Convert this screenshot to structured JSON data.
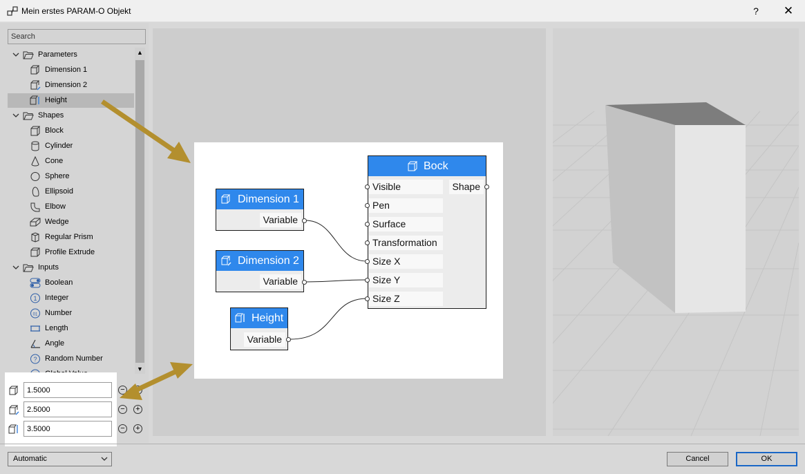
{
  "window": {
    "title": "Mein erstes PARAM-O Objekt",
    "help": "?",
    "close": "✕"
  },
  "search": {
    "placeholder": "Search"
  },
  "tree": {
    "parameters": {
      "label": "Parameters",
      "items": [
        "Dimension 1",
        "Dimension 2",
        "Height"
      ]
    },
    "shapes": {
      "label": "Shapes",
      "items": [
        "Block",
        "Cylinder",
        "Cone",
        "Sphere",
        "Ellipsoid",
        "Elbow",
        "Wedge",
        "Regular Prism",
        "Profile Extrude"
      ]
    },
    "inputs": {
      "label": "Inputs",
      "items": [
        "Boolean",
        "Integer",
        "Number",
        "Length",
        "Angle",
        "Random Number",
        "Global Value"
      ]
    },
    "selected": "Height"
  },
  "values": [
    {
      "name": "Dimension 1",
      "value": "1.5000"
    },
    {
      "name": "Dimension 2",
      "value": "2.5000"
    },
    {
      "name": "Height",
      "value": "3.5000"
    }
  ],
  "graph": {
    "nodes": {
      "dim1": {
        "title": "Dimension 1",
        "output": "Variable"
      },
      "dim2": {
        "title": "Dimension 2",
        "output": "Variable"
      },
      "height": {
        "title": "Height",
        "output": "Variable"
      },
      "block": {
        "title": "Bock",
        "inputs": [
          "Visible",
          "Pen",
          "Surface",
          "Transformation",
          "Size X",
          "Size Y",
          "Size Z"
        ],
        "output": "Shape"
      }
    },
    "connections": [
      {
        "from": "Dimension 1.Variable",
        "to": "Bock.Size X"
      },
      {
        "from": "Dimension 2.Variable",
        "to": "Bock.Size Y"
      },
      {
        "from": "Height.Variable",
        "to": "Bock.Size Z"
      }
    ]
  },
  "footer": {
    "mode": "Automatic",
    "cancel": "Cancel",
    "ok": "OK"
  },
  "colors": {
    "node_header": "#2f88ec",
    "annotation_arrow": "#b38f2e",
    "ok_border": "#1a67c6"
  }
}
